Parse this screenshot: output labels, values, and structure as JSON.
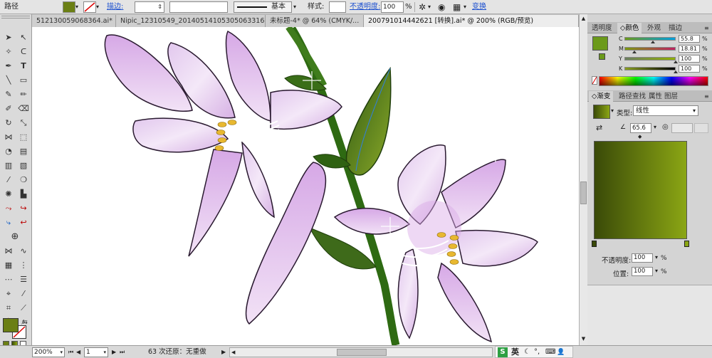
{
  "control_bar": {
    "object_type": "路径",
    "stroke_label": "描边:",
    "stroke_style": "基本",
    "style_label": "样式:",
    "opacity_label": "不透明度:",
    "opacity_value": "100",
    "opacity_unit": "%",
    "transform_link": "变换",
    "fill_color": "#6b7f14"
  },
  "tabs": [
    {
      "label": "512130059068364.ai*",
      "active": false
    },
    {
      "label": "Nipic_12310549_20140514105305063316.ai*",
      "active": false
    },
    {
      "label": "未标题-4* @ 64% (CMYK/...",
      "active": false
    },
    {
      "label": "200791014442621 [转换].ai* @ 200% (RGB/预览)",
      "active": true
    }
  ],
  "color_panel": {
    "tabs": [
      "透明度",
      "颜色",
      "外观",
      "描边"
    ],
    "active_tab": "颜色",
    "channels": [
      {
        "name": "C",
        "value": "55.8",
        "unit": "%",
        "fraction": 0.558,
        "track_from": "#6b9a1a",
        "track_to": "#00a0e0"
      },
      {
        "name": "M",
        "value": "18.81",
        "unit": "%",
        "fraction": 0.188,
        "track_from": "#7a9a10",
        "track_to": "#c02060"
      },
      {
        "name": "Y",
        "value": "100",
        "unit": "%",
        "fraction": 1.0,
        "track_from": "#6b7f60",
        "track_to": "#8fb000"
      },
      {
        "name": "K",
        "value": "100",
        "unit": "%",
        "fraction": 1.0,
        "track_from": "#8aa020",
        "track_to": "#000000"
      }
    ],
    "swatch": "#6b9a1a"
  },
  "gradient_panel": {
    "tabs": [
      "渐变",
      "路径查找",
      "属性",
      "图层"
    ],
    "active_tab": "渐变",
    "type_label": "类型:",
    "type_value": "线性",
    "angle_value": "65.6",
    "opacity_label": "不透明度:",
    "opacity_value": "100",
    "position_label": "位置:",
    "position_value": "100",
    "unit": "%",
    "stop_left": "#3a4a08",
    "stop_right": "#8ba614"
  },
  "status_bar": {
    "zoom": "200%",
    "page": "1",
    "undo_status": "63 次还原：无重做"
  },
  "ime_bar": {
    "logo": "S",
    "mode": "英"
  }
}
